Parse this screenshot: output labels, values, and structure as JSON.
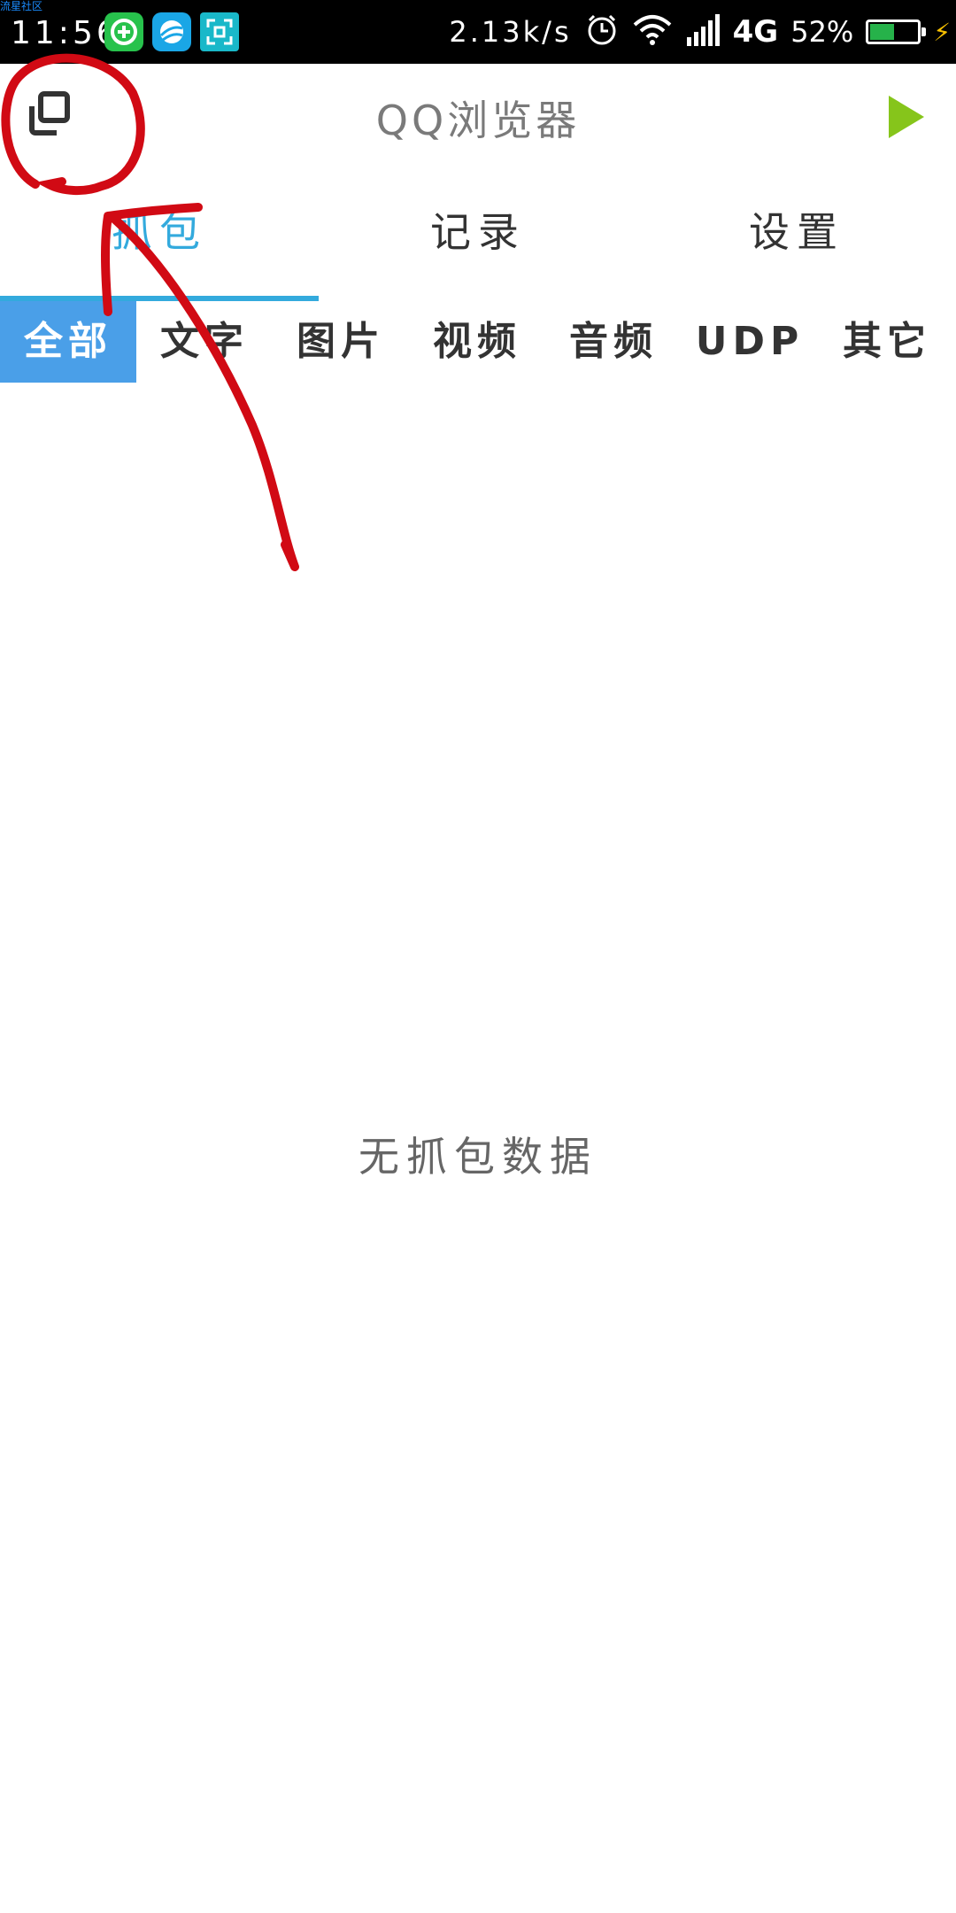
{
  "status_bar": {
    "watermark": "流星社区",
    "time": "11:56",
    "speed": "2.13k/s",
    "network": "4G",
    "battery_percent": "52%",
    "battery_level": 0.52,
    "icons": [
      "add-circle-icon",
      "planet-icon",
      "scan-icon",
      "alarm-icon",
      "wifi-icon",
      "signal-icon",
      "battery-icon",
      "charging-icon"
    ],
    "app_icon_colors": [
      "#27c24c",
      "#1aa6e6",
      "#19b8c9"
    ]
  },
  "app_bar": {
    "title": "QQ浏览器",
    "window_icon": "window-switch-icon",
    "play_icon": "play-icon",
    "play_color": "#86c51b"
  },
  "main_tabs": [
    {
      "label": "抓包",
      "active": true
    },
    {
      "label": "记录",
      "active": false
    },
    {
      "label": "设置",
      "active": false
    }
  ],
  "category_tabs": [
    {
      "label": "全部",
      "active": true
    },
    {
      "label": "文字",
      "active": false
    },
    {
      "label": "图片",
      "active": false
    },
    {
      "label": "视频",
      "active": false
    },
    {
      "label": "音频",
      "active": false
    },
    {
      "label": "UDP",
      "active": false
    },
    {
      "label": "其它",
      "active": false
    }
  ],
  "empty_state": {
    "text": "无抓包数据"
  },
  "colors": {
    "accent": "#33aadd",
    "category_active": "#4a9fe8",
    "annotation": "#d10a14"
  }
}
